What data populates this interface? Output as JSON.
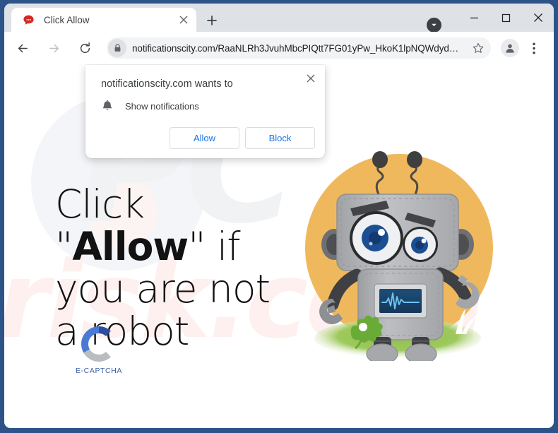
{
  "window": {
    "frame_color": "#2d5389",
    "controls": {
      "tab_search_label": "▼",
      "minimize_label": "—",
      "maximize_label": "□",
      "close_label": "✕"
    }
  },
  "tabstrip": {
    "tab": {
      "title": "Click Allow",
      "favicon": "speech-bubble-favicon",
      "close_label": "✕"
    },
    "new_tab_label": "+"
  },
  "toolbar": {
    "back_label": "←",
    "forward_label": "→",
    "reload_label": "⟳",
    "lock_icon": "lock-icon",
    "url": "notificationscity.com/RaaNLRh3JvuhMbcPIQtt7FG01yPw_HkoK1lpNQWdyd…",
    "bookmark_label": "☆",
    "profile_icon": "profile-avatar-icon",
    "menu_label": "⋮"
  },
  "dialog": {
    "title": "notificationscity.com wants to",
    "permission_icon": "bell-icon",
    "permission_label": "Show notifications",
    "allow_label": "Allow",
    "block_label": "Block",
    "close_label": "✕",
    "button_text_color": "#1a73e8"
  },
  "page": {
    "headline_prefix": "Click \"",
    "headline_emphasis": "Allow",
    "headline_suffix": "\" if you are not a robot",
    "captcha_label": "E-CAPTCHA",
    "captcha_mark": "letter-c-logo",
    "robot_alt": "cartoon-robot-illustration",
    "watermark_primary": "PC",
    "watermark_secondary": "risk.com",
    "accent_orange": "#f0b859",
    "accent_green": "#86b84a",
    "robot_body_gray": "#b0b2b4",
    "eye_blue": "#1b4f93"
  }
}
